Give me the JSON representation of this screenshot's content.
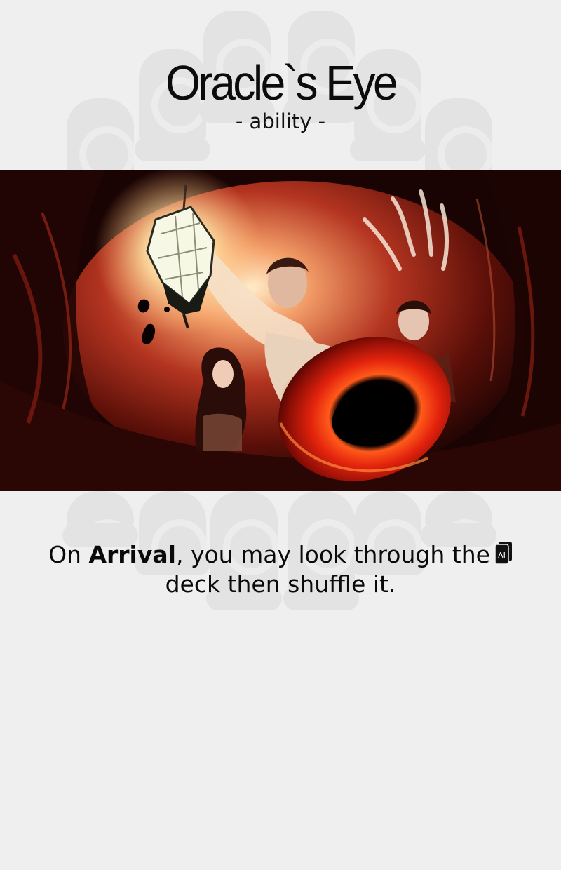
{
  "card": {
    "title": "Oracle`s Eye",
    "subtitle": "-  ability -",
    "illustration": "eye-lantern-illustration"
  },
  "ability": {
    "prefix": "On ",
    "keyword": "Arrival",
    "middle": ", you may look through the",
    "icon": "deck-card-icon",
    "icon_label": "AI",
    "suffix": "deck then shuffle it."
  },
  "colors": {
    "background": "#efefef",
    "ornament": "#e3e3e3",
    "text": "#111111",
    "art_red": "#c8281a",
    "art_glow": "#ffd98a"
  }
}
